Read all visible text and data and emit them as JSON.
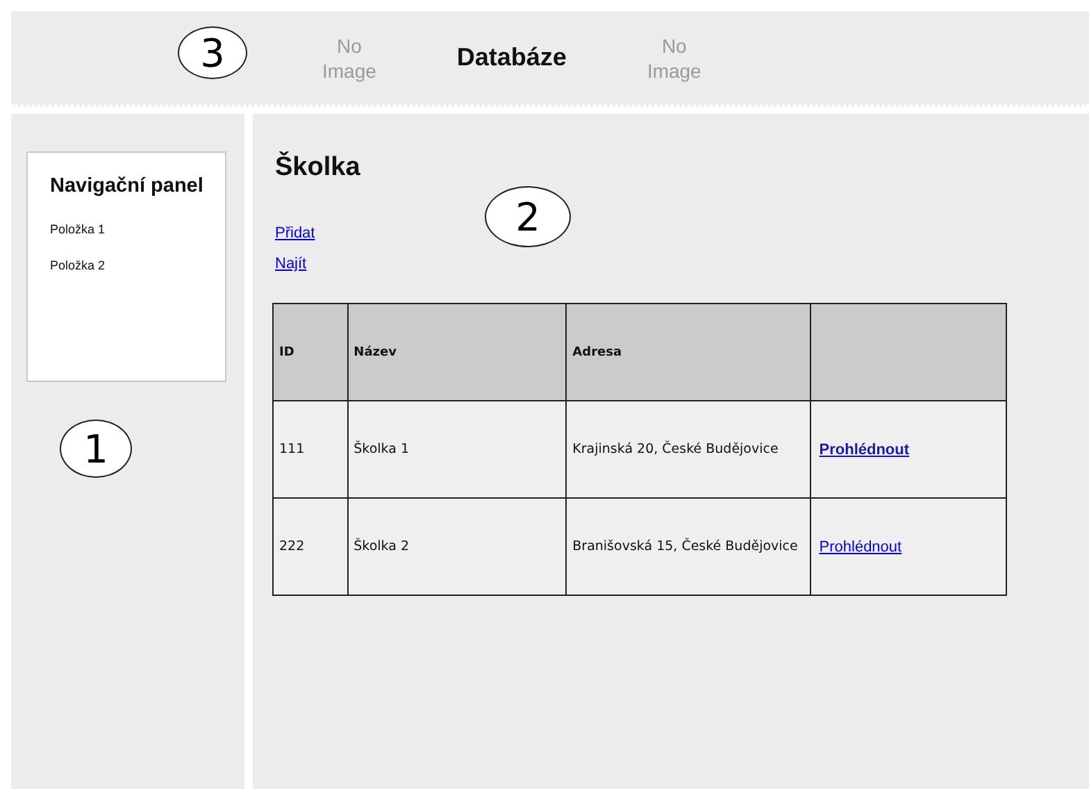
{
  "header": {
    "callout": "3",
    "items": [
      {
        "kind": "placeholder",
        "text": "No Image"
      },
      {
        "kind": "title",
        "text": "Databáze"
      },
      {
        "kind": "placeholder",
        "text": "No Image"
      }
    ]
  },
  "sidebar": {
    "title": "Navigační panel",
    "items": [
      "Položka 1",
      "Položka 2"
    ],
    "callout": "1"
  },
  "main": {
    "title": "Školka",
    "callout": "2",
    "links": [
      "Přidat",
      "Najít"
    ],
    "table": {
      "columns": [
        "ID",
        "Název",
        "Adresa"
      ],
      "rows": [
        {
          "cells": [
            "111",
            "Školka 1",
            "Krajinská 20, České Budějovice"
          ],
          "link": {
            "text": "Prohlédnout",
            "selected": true
          }
        },
        {
          "cells": [
            "222",
            "Školka 2",
            "Branišovská 15, České Budějovice"
          ],
          "link": {
            "text": "Prohlédnout",
            "selected": false
          }
        }
      ]
    }
  }
}
